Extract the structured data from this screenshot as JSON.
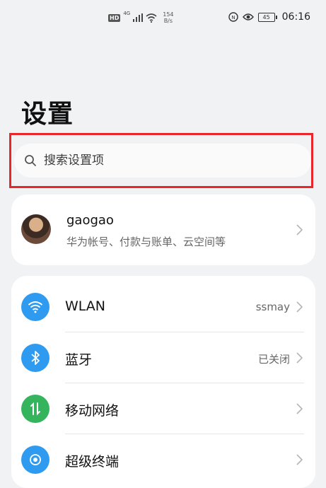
{
  "status_bar": {
    "network_type": "4G",
    "hd_label": "HD",
    "speed_value": "154",
    "speed_unit": "B/s",
    "battery": "45",
    "time": "06:16"
  },
  "page": {
    "title": "设置"
  },
  "search": {
    "placeholder": "搜索设置项"
  },
  "account": {
    "name": "gaogao",
    "subtitle": "华为帐号、付款与账单、云空间等"
  },
  "settings": [
    {
      "label": "WLAN",
      "value": "ssmay",
      "icon": "wifi-icon",
      "color": "#2f9bf0"
    },
    {
      "label": "蓝牙",
      "value": "已关闭",
      "icon": "bluetooth-icon",
      "color": "#2f9bf0"
    },
    {
      "label": "移动网络",
      "value": "",
      "icon": "mobile-data-icon",
      "color": "#34b45c"
    },
    {
      "label": "超级终端",
      "value": "",
      "icon": "super-device-icon",
      "color": "#2f9bf0"
    }
  ],
  "colors": {
    "highlight": "#e8262b",
    "background": "#f1f2f4"
  }
}
